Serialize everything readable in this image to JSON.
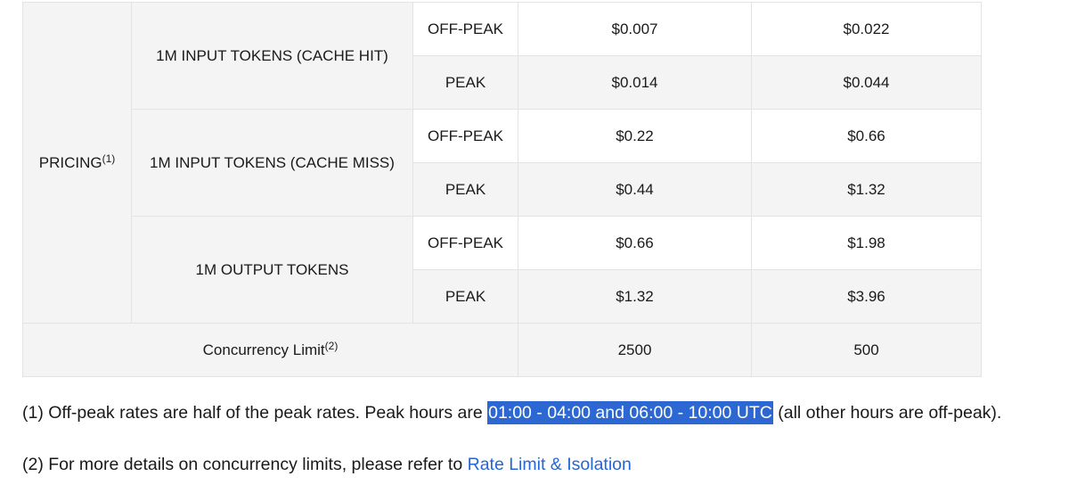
{
  "pricing_label": "PRICING",
  "pricing_sup": "(1)",
  "groups": [
    {
      "name": "1M INPUT TOKENS (CACHE HIT)",
      "rows": [
        {
          "period": "OFF-PEAK",
          "col1": "$0.007",
          "col2": "$0.022"
        },
        {
          "period": "PEAK",
          "col1": "$0.014",
          "col2": "$0.044"
        }
      ]
    },
    {
      "name": "1M INPUT TOKENS (CACHE MISS)",
      "rows": [
        {
          "period": "OFF-PEAK",
          "col1": "$0.22",
          "col2": "$0.66"
        },
        {
          "period": "PEAK",
          "col1": "$0.44",
          "col2": "$1.32"
        }
      ]
    },
    {
      "name": "1M OUTPUT TOKENS",
      "rows": [
        {
          "period": "OFF-PEAK",
          "col1": "$0.66",
          "col2": "$1.98"
        },
        {
          "period": "PEAK",
          "col1": "$1.32",
          "col2": "$3.96"
        }
      ]
    }
  ],
  "concurrency": {
    "label": "Concurrency Limit",
    "sup": "(2)",
    "col1": "2500",
    "col2": "500"
  },
  "notes": {
    "note1_before": "(1) Off-peak rates are half of the peak rates. Peak hours are ",
    "note1_highlight": "01:00 - 04:00 and 06:00 - 10:00 UTC",
    "note1_after": " (all other hours are off-peak).",
    "note2_before": "(2) For more details on concurrency limits, please refer to ",
    "note2_link": "Rate Limit & Isolation"
  },
  "colors": {
    "highlight": "#2d67d2",
    "link": "#2565d6",
    "row_gray": "#f4f4f4",
    "border": "#e3e3e3"
  }
}
